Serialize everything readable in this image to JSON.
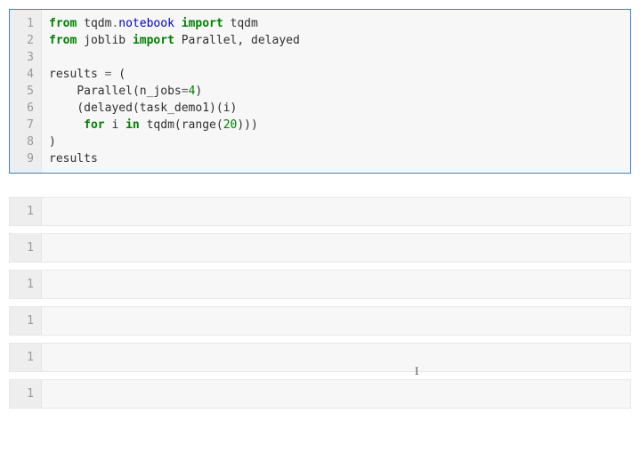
{
  "main_cell": {
    "line_numbers": [
      "1",
      "2",
      "3",
      "4",
      "5",
      "6",
      "7",
      "8",
      "9"
    ],
    "tokens": {
      "l1_from": "from",
      "l1_tqdm": "tqdm",
      "l1_dot": ".",
      "l1_notebook": "notebook",
      "l1_import": "import",
      "l1_tqdm2": "tqdm",
      "l2_from": "from",
      "l2_joblib": "joblib",
      "l2_import": "import",
      "l2_parallel": "Parallel",
      "l2_comma": ", ",
      "l2_delayed": "delayed",
      "l4_results": "results ",
      "l4_eq": "=",
      "l4_open": " (",
      "l5_indent": "    ",
      "l5_parallel": "Parallel",
      "l5_open": "(",
      "l5_njobs": "n_jobs",
      "l5_eq": "=",
      "l5_four": "4",
      "l5_close": ")",
      "l6_indent": "    ",
      "l6_open": "(",
      "l6_delayed": "delayed",
      "l6_open2": "(",
      "l6_task": "task_demo1",
      "l6_close2": ")(",
      "l6_i": "i",
      "l6_close3": ")",
      "l7_indent": "     ",
      "l7_for": "for",
      "l7_sp": " ",
      "l7_i": "i",
      "l7_sp2": " ",
      "l7_in": "in",
      "l7_sp3": " ",
      "l7_tqdm": "tqdm",
      "l7_open": "(",
      "l7_range": "range",
      "l7_open2": "(",
      "l7_twenty": "20",
      "l7_close": ")))",
      "l8_close": ")",
      "l9_results": "results"
    }
  },
  "output_cells": [
    {
      "line_number": "1",
      "content": ""
    },
    {
      "line_number": "1",
      "content": ""
    },
    {
      "line_number": "1",
      "content": ""
    },
    {
      "line_number": "1",
      "content": ""
    },
    {
      "line_number": "1",
      "content": ""
    },
    {
      "line_number": "1",
      "content": ""
    }
  ],
  "cursor_glyph": "I"
}
